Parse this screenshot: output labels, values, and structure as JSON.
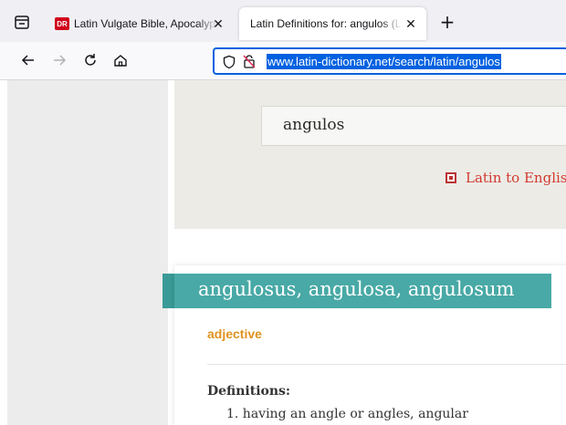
{
  "browser": {
    "tabs": [
      {
        "title": "Latin Vulgate Bible, Apocalypse",
        "favicon_text": "DR"
      },
      {
        "title": "Latin Definitions for: angulos (Latin"
      }
    ],
    "tab_close_glyph": "✕",
    "new_tab_glyph": "+",
    "url": "www.latin-dictionary.net/search/latin/angulos",
    "accent_color": "#0061e0"
  },
  "search": {
    "value": "angulos",
    "direction_label": "Latin to English"
  },
  "entry": {
    "headword": "angulosus, angulosa, angulosum",
    "part_of_speech": "adjective",
    "definitions_heading": "Definitions:",
    "definitions": [
      "1. having an angle or angles, angular"
    ]
  },
  "colors": {
    "headword_band": "#48a9a6",
    "part_of_speech": "#e0921f",
    "direction_label": "#d23a2e"
  }
}
